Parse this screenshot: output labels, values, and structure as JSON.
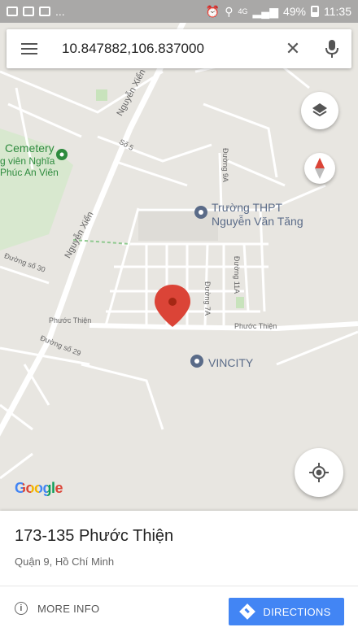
{
  "status_bar": {
    "ellipsis": "...",
    "network": "4G",
    "battery": "49%",
    "time": "11:35"
  },
  "search": {
    "query": "10.847882,106.837000"
  },
  "map": {
    "labels": {
      "cemetery": "Cemetery",
      "cemetery_line2": "g viên Nghĩa",
      "cemetery_line3": "Phúc An Viên",
      "school_line1": "Trường THPT",
      "school_line2": "Nguyễn Văn Tăng",
      "vincity": "VINCITY"
    },
    "roads": {
      "nguyen_xien_1": "Nguyễn Xiển",
      "nguyen_xien_2": "Nguyễn Xiển",
      "so5": "Số 5",
      "duong9a": "Đường 9A",
      "duong30": "Đường số 30",
      "duong11a": "Đường 11A",
      "duong7a": "Đường 7A",
      "phuoc_thien_1": "Phước Thiện",
      "phuoc_thien_2": "Phước Thiện",
      "duong29": "Đường số 29"
    },
    "logo": "Google"
  },
  "place": {
    "title": "173-135 Phước Thiện",
    "subtitle": "Quận 9, Hồ Chí Minh"
  },
  "actions": {
    "more_info": "MORE INFO",
    "directions": "DIRECTIONS"
  },
  "colors": {
    "accent": "#4285f4",
    "pin": "#db4437",
    "poi": "#5a6b88",
    "park": "#2e8b3e"
  }
}
